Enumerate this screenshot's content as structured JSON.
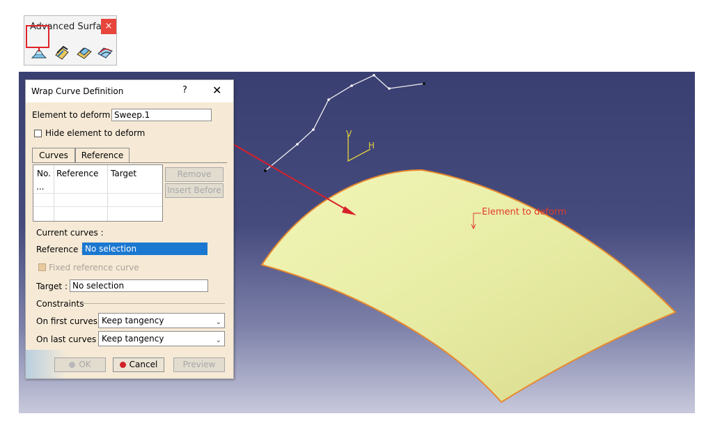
{
  "toolbar": {
    "title": "Advanced Surfa...",
    "close_glyph": "×",
    "icons": [
      "bump-icon",
      "wrap-curve-icon",
      "wrap-surface-icon",
      "shape-morphing-icon"
    ]
  },
  "viewport": {
    "annotation": "Element to deform",
    "axis_labels": {
      "v": "V",
      "h": "H"
    },
    "colors": {
      "surface": "#eef3a6",
      "surface_edge": "#e8892e",
      "annotation": "#e23b2b",
      "arrow": "#d8202a"
    }
  },
  "dialog": {
    "title": "Wrap Curve Definition",
    "help_glyph": "?",
    "close_glyph": "✕",
    "element_label": "Element to deform :",
    "element_value": "Sweep.1",
    "hide_label": "Hide element to deform",
    "tabs": [
      {
        "label": "Curves"
      },
      {
        "label": "Reference"
      }
    ],
    "table": {
      "headers": [
        "No.",
        "Reference",
        "Target"
      ],
      "rows": [
        [
          "...",
          "",
          ""
        ]
      ]
    },
    "remove_label": "Remove",
    "insert_before_label": "Insert Before",
    "current_curves_label": "Current curves :",
    "reference_label": "Reference :",
    "reference_value": "No selection",
    "fixed_reference_label": "Fixed reference curve",
    "target_label": "Target :",
    "target_value": "No selection",
    "constraints_label": "Constraints",
    "first_curves_label": "On first curves :",
    "first_curves_value": "Keep tangency",
    "last_curves_label": "On last curves :",
    "last_curves_value": "Keep tangency",
    "ok_label": "OK",
    "cancel_label": "Cancel",
    "preview_label": "Preview"
  }
}
